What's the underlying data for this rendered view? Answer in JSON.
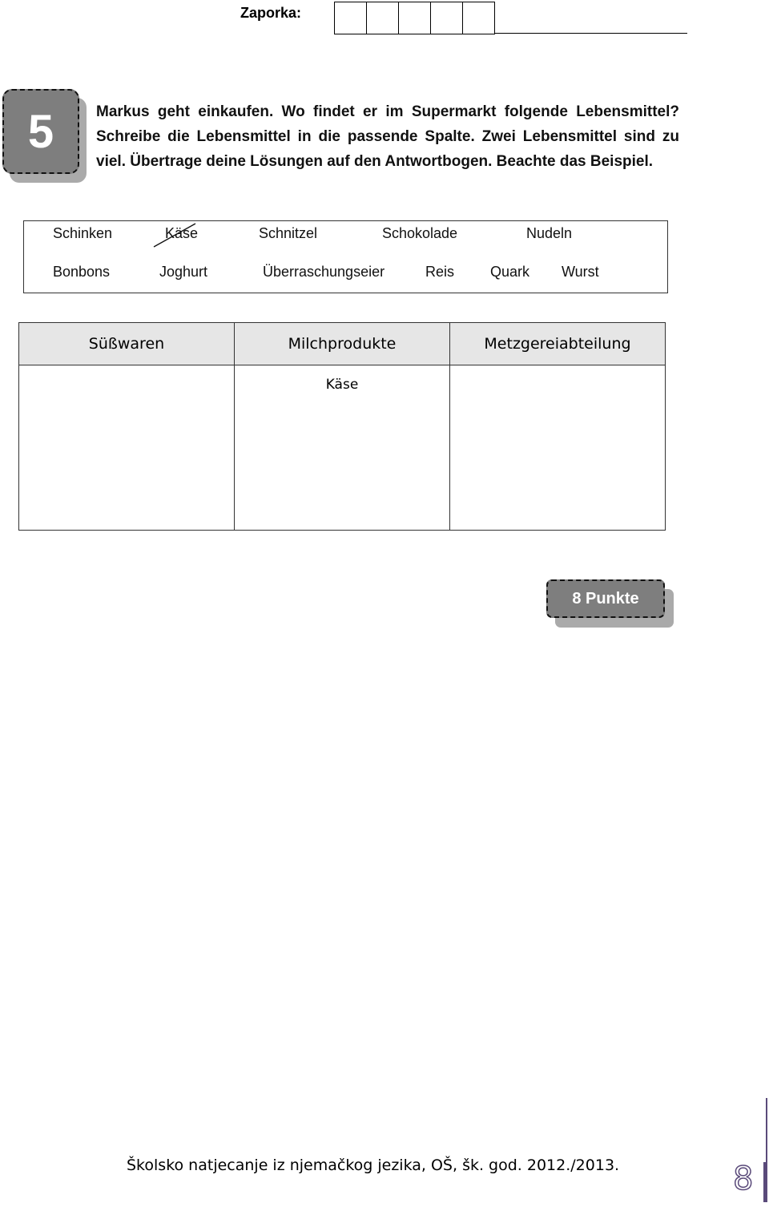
{
  "header": {
    "password_label": "Zaporka:",
    "password_boxes": 5
  },
  "task": {
    "number": "5",
    "instructions": "Markus geht einkaufen. Wo findet er im Supermarkt folgende Lebensmittel? Schreibe die Lebensmittel in die passende Spalte. Zwei Lebensmittel sind zu viel. Übertrage deine Lösungen auf den Antwortbogen. Beachte das Beispiel."
  },
  "words": {
    "row1": [
      "Schinken",
      "Käse",
      "Schnitzel",
      "Schokolade",
      "Nudeln"
    ],
    "row2": [
      "Bonbons",
      "Joghurt",
      "Überraschungseier",
      "Reis",
      "Quark",
      "Wurst"
    ],
    "crossed_out": "Käse"
  },
  "table": {
    "headers": [
      "Süßwaren",
      "Milchprodukte",
      "Metzgereiabteilung"
    ],
    "cells": [
      "",
      "Käse",
      ""
    ]
  },
  "points": "8 Punkte",
  "footer": {
    "text": "Školsko natjecanje iz njemačkog jezika, OŠ, šk. god. 2012./2013.",
    "page": "8",
    "accent": "#5a4a7a"
  }
}
